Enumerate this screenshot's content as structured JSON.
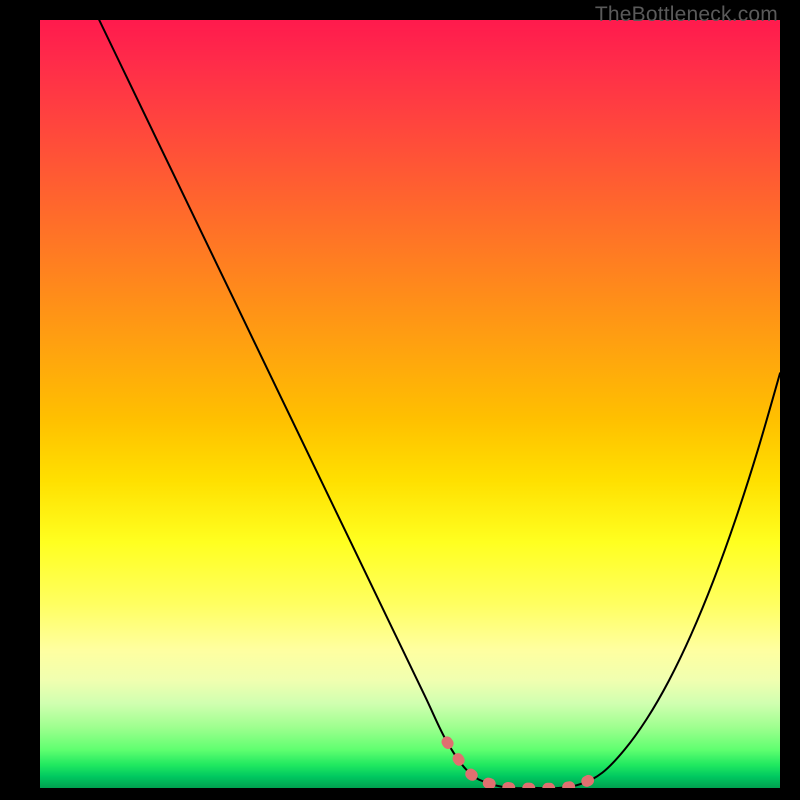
{
  "watermark": "TheBottleneck.com",
  "chart_data": {
    "type": "line",
    "title": "",
    "xlabel": "",
    "ylabel": "",
    "xlim": [
      0,
      100
    ],
    "ylim": [
      0,
      100
    ],
    "series": [
      {
        "name": "curve",
        "x": [
          8,
          12,
          16,
          20,
          24,
          28,
          32,
          36,
          40,
          44,
          48,
          52,
          55,
          58,
          61,
          64,
          67,
          70,
          73,
          76,
          79,
          82,
          85,
          88,
          91,
          94,
          97,
          100
        ],
        "values": [
          100,
          92,
          84,
          76,
          68,
          60,
          52,
          44,
          36,
          28,
          20,
          12,
          6,
          2,
          0.5,
          0,
          0,
          0,
          0.5,
          2,
          5,
          9,
          14,
          20,
          27,
          35,
          44,
          54
        ]
      },
      {
        "name": "flat-highlight",
        "x": [
          55,
          58,
          61,
          64,
          67,
          70,
          73,
          76
        ],
        "values": [
          6,
          2,
          0.5,
          0,
          0,
          0,
          0.5,
          2
        ]
      }
    ],
    "colors": {
      "curve": "#000000",
      "flat_highlight": "#e07070",
      "gradient_top": "#ff1a4d",
      "gradient_mid": "#ffe000",
      "gradient_bottom": "#00a050"
    }
  }
}
